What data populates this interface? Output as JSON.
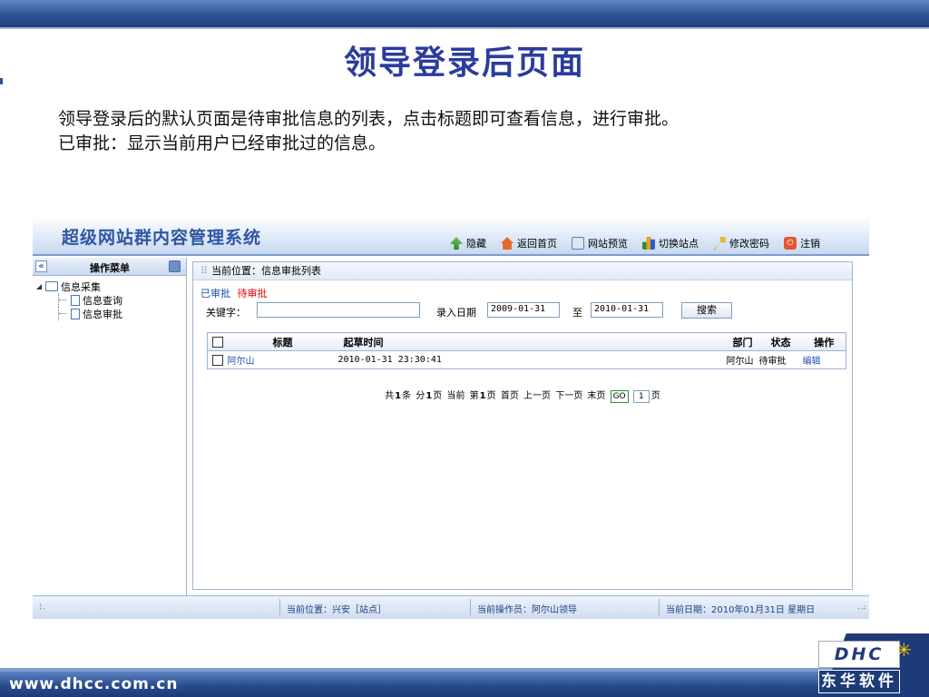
{
  "slide": {
    "title": "领导登录后页面",
    "desc_line1": "领导登录后的默认页面是待审批信息的列表，点击标题即可查看信息，进行审批。",
    "desc_line2": "已审批：显示当前用户已经审批过的信息。",
    "footer_url": "www.dhcc.com.cn",
    "logo_text": "DHC",
    "logo_cn": "东华软件"
  },
  "app": {
    "title": "超级网站群内容管理系统",
    "toolbar": [
      {
        "label": "隐藏",
        "icon": "hide-icon"
      },
      {
        "label": "返回首页",
        "icon": "home-icon"
      },
      {
        "label": "网站预览",
        "icon": "preview-icon"
      },
      {
        "label": "切换站点",
        "icon": "switch-site-icon"
      },
      {
        "label": "修改密码",
        "icon": "key-icon"
      },
      {
        "label": "注销",
        "icon": "logout-icon"
      }
    ],
    "sidebar": {
      "collapse_glyph": "«",
      "title": "操作菜单",
      "items": [
        {
          "label": "信息采集",
          "icon": "folder-icon"
        },
        {
          "label": "信息查询",
          "icon": "file-icon"
        },
        {
          "label": "信息审批",
          "icon": "file-icon"
        }
      ]
    },
    "main": {
      "crumb_dots": "⠿",
      "breadcrumb": "当前位置：信息审批列表",
      "tab_done": "已审批",
      "tab_pending": "待审批",
      "keyword_label": "关键字：",
      "keyword_value": "",
      "date_label": "录入日期",
      "date_from": "2009-01-31",
      "date_to_label": "至",
      "date_to": "2010-01-31",
      "search_button": "搜索",
      "columns": {
        "title": "标题",
        "time": "起草时间",
        "dept": "部门",
        "status": "状态",
        "action": "操作"
      },
      "rows": [
        {
          "title": "阿尔山",
          "time": "2010-01-31 23:30:41",
          "dept": "阿尔山",
          "status": "待审批",
          "action": "编辑"
        }
      ],
      "pager": {
        "total_prefix": "共",
        "total": "1",
        "total_suffix": "条",
        "pages_prefix": "分",
        "pages": "1",
        "pages_suffix": "页",
        "current_prefix": "当前",
        "current_mid": "第",
        "current": "1",
        "current_suffix": "页",
        "first": "首页",
        "prev": "上一页",
        "next": "下一页",
        "last": "末页",
        "go": "GO",
        "page_input": "1",
        "page_unit": "页"
      }
    },
    "status": {
      "grip_left": "⠸⠄",
      "location": "当前位置：兴安［站点］",
      "operator": "当前操作员：阿尔山领导",
      "date": "当前日期：2010年01月31日 星期日",
      "grip_right": "⠠⠴"
    }
  }
}
